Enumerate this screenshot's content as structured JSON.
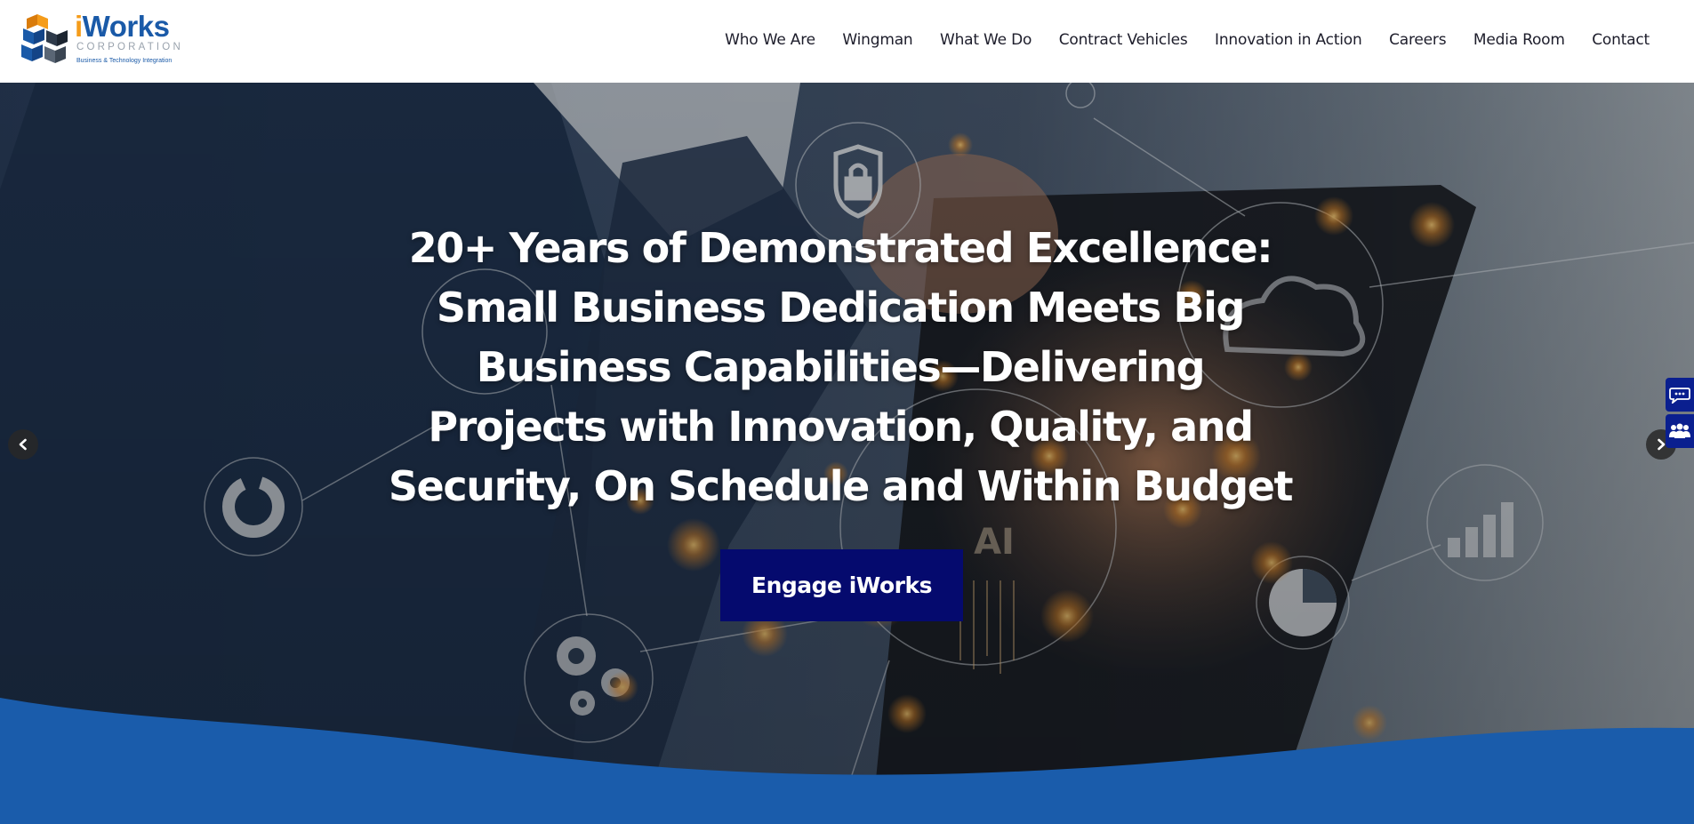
{
  "logo": {
    "brand_i": "i",
    "brand_rest": "Works",
    "corporation": "CORPORATION",
    "tagline": "Business & Technology Integration"
  },
  "nav": {
    "items": [
      "Who We Are",
      "Wingman",
      "What We Do",
      "Contract Vehicles",
      "Innovation in Action",
      "Careers",
      "Media Room",
      "Contact"
    ]
  },
  "hero": {
    "headline": "20+ Years of Demonstrated Excellence: Small Business Dedication Meets Big Business Capabilities—Delivering Projects with Innovation, Quality, and Security, On Schedule and Within Budget",
    "cta_label": "Engage iWorks",
    "overlay_icon_label": "AI"
  },
  "icons": {
    "prev": "chevron-left-icon",
    "next": "chevron-right-icon",
    "chat": "chat-icon",
    "team": "team-icon"
  },
  "colors": {
    "brand_blue": "#1a5aa8",
    "brand_orange": "#f59c1a",
    "cta_bg": "#050a6e",
    "wave_blue": "#1a5cab",
    "side_widget": "#0a1f8f"
  }
}
